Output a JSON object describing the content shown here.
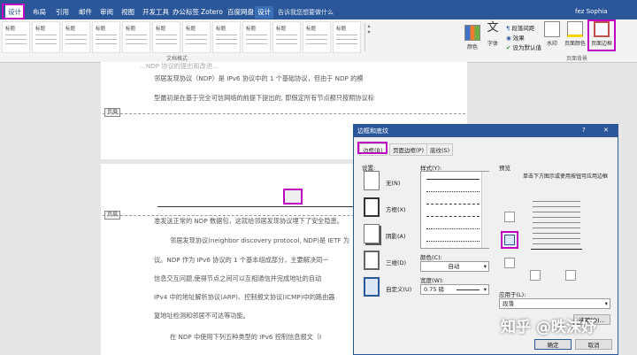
{
  "app": {
    "title": "Word",
    "context_group": "页眉和页脚工具"
  },
  "tabs": [
    "设计",
    "布局",
    "引用",
    "邮件",
    "审阅",
    "视图",
    "开发工具",
    "办公标签",
    "Zotero",
    "百度网盘",
    "设计"
  ],
  "tell_me": "告诉我您想要做什么",
  "user": "fez Sophia",
  "gallery": {
    "items": [
      "标题",
      "标题",
      "标题",
      "标题",
      "标题",
      "标题",
      "标题",
      "标题",
      "标题",
      "标题",
      "标题",
      "标题"
    ],
    "group_label": "文档格式"
  },
  "ribbon_buttons": {
    "colors": "颜色",
    "fonts": "字体",
    "paragraph_spacing": "段落间距",
    "effects": "效果",
    "set_default": "设为默认值",
    "watermark": "水印",
    "page_color": "页面颜色",
    "page_borders": "页面边框",
    "page_bg_label": "页面背景"
  },
  "document": {
    "header_tag": "页眉",
    "lines_top": [
      "邻居发现协议（NDP）是 IPv6 协议中的 1 个基础协议，但由于 NDP 的模",
      "型最初是在基于完全可信网络的前提下提出的, 即假定所有节点都只按照协议标"
    ],
    "header_tag_2": "页眉",
    "lines_bottom": [
      "准发送正常的 NDP 数据包，这就给邻居发现协议埋下了安全隐患。",
      "邻居发现协议(neighbor discovery protocol, NDP)是 IETF 为",
      "议。NDP 作为 IPv6 协议的 1 个基本组成部分，主要解决同一",
      "信息交互问题,使得节点之间可以互相通信并完成地址的自动",
      "IPv4 中的地址解析协议(ARP)、控制报文协议(ICMP)中的路由器",
      "复地址检测和邻居不可达等功能。",
      "在 NDP 中使用下列五种类型的 IPv6 控制信息报文（I"
    ]
  },
  "dialog": {
    "title": "边框和底纹",
    "help": "?",
    "close": "✕",
    "tabs": [
      "边框(B)",
      "页面边框(P)",
      "底纹(S)"
    ],
    "setting_label": "设置:",
    "settings": [
      "无(N)",
      "方框(X)",
      "阴影(A)",
      "三维(D)",
      "自定义(U)"
    ],
    "style_label": "样式(Y):",
    "color_label": "颜色(C):",
    "color_value": "自动",
    "width_label": "宽度(W):",
    "width_value": "0.75 磅",
    "preview_label": "预览",
    "preview_hint": "单击下方图示或使用按钮可应用边框",
    "apply_to_label": "应用于(L):",
    "apply_to_value": "段落",
    "options_button": "选项(O)...",
    "ok_button": "确定",
    "cancel_button": "取消"
  },
  "watermark_text": "知乎 @昳沫妤",
  "colors": {
    "accent": "#2b579a",
    "highlight": "#c000c0"
  }
}
